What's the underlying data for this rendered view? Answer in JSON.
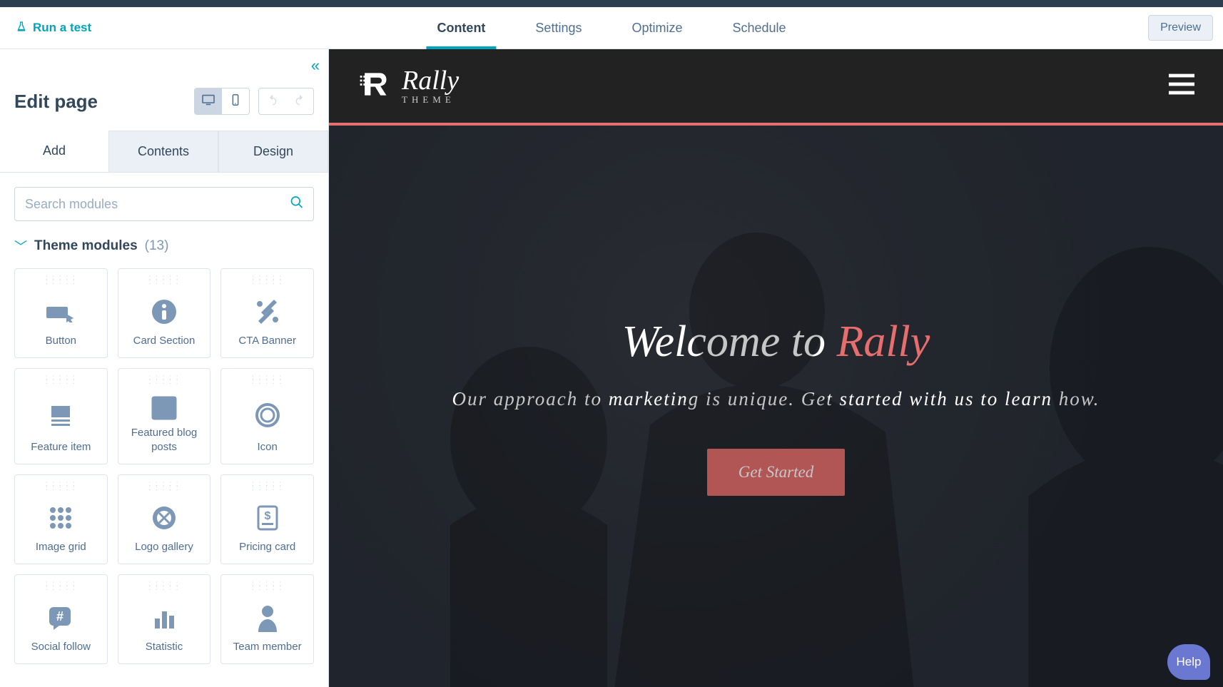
{
  "toolbar": {
    "run_test": "Run a test",
    "tabs": [
      "Content",
      "Settings",
      "Optimize",
      "Schedule"
    ],
    "active_tab": "Content",
    "preview": "Preview"
  },
  "sidebar": {
    "title": "Edit page",
    "subtabs": [
      "Add",
      "Contents",
      "Design"
    ],
    "active_subtab": "Add",
    "search_placeholder": "Search modules",
    "section_title": "Theme modules",
    "section_count": "(13)",
    "modules": [
      {
        "label": "Button",
        "icon": "button"
      },
      {
        "label": "Card Section",
        "icon": "info"
      },
      {
        "label": "CTA Banner",
        "icon": "tools"
      },
      {
        "label": "Feature item",
        "icon": "feature"
      },
      {
        "label": "Featured blog posts",
        "icon": "news"
      },
      {
        "label": "Icon",
        "icon": "circle"
      },
      {
        "label": "Image grid",
        "icon": "grid"
      },
      {
        "label": "Logo gallery",
        "icon": "badge"
      },
      {
        "label": "Pricing card",
        "icon": "price"
      },
      {
        "label": "Social follow",
        "icon": "hash"
      },
      {
        "label": "Statistic",
        "icon": "bars"
      },
      {
        "label": "Team member",
        "icon": "person"
      }
    ]
  },
  "preview": {
    "logo_main": "Rally",
    "logo_sub": "THEME",
    "hero_title_pre": "Welcome to ",
    "hero_title_accent": "Rally",
    "hero_sub": "Our approach to marketing is unique. Get started with us to learn how.",
    "cta": "Get Started"
  },
  "help": "Help",
  "colors": {
    "hubspot_teal": "#00a4bd",
    "accent_red": "#e66e6e",
    "help_purple": "#6a78d1"
  }
}
